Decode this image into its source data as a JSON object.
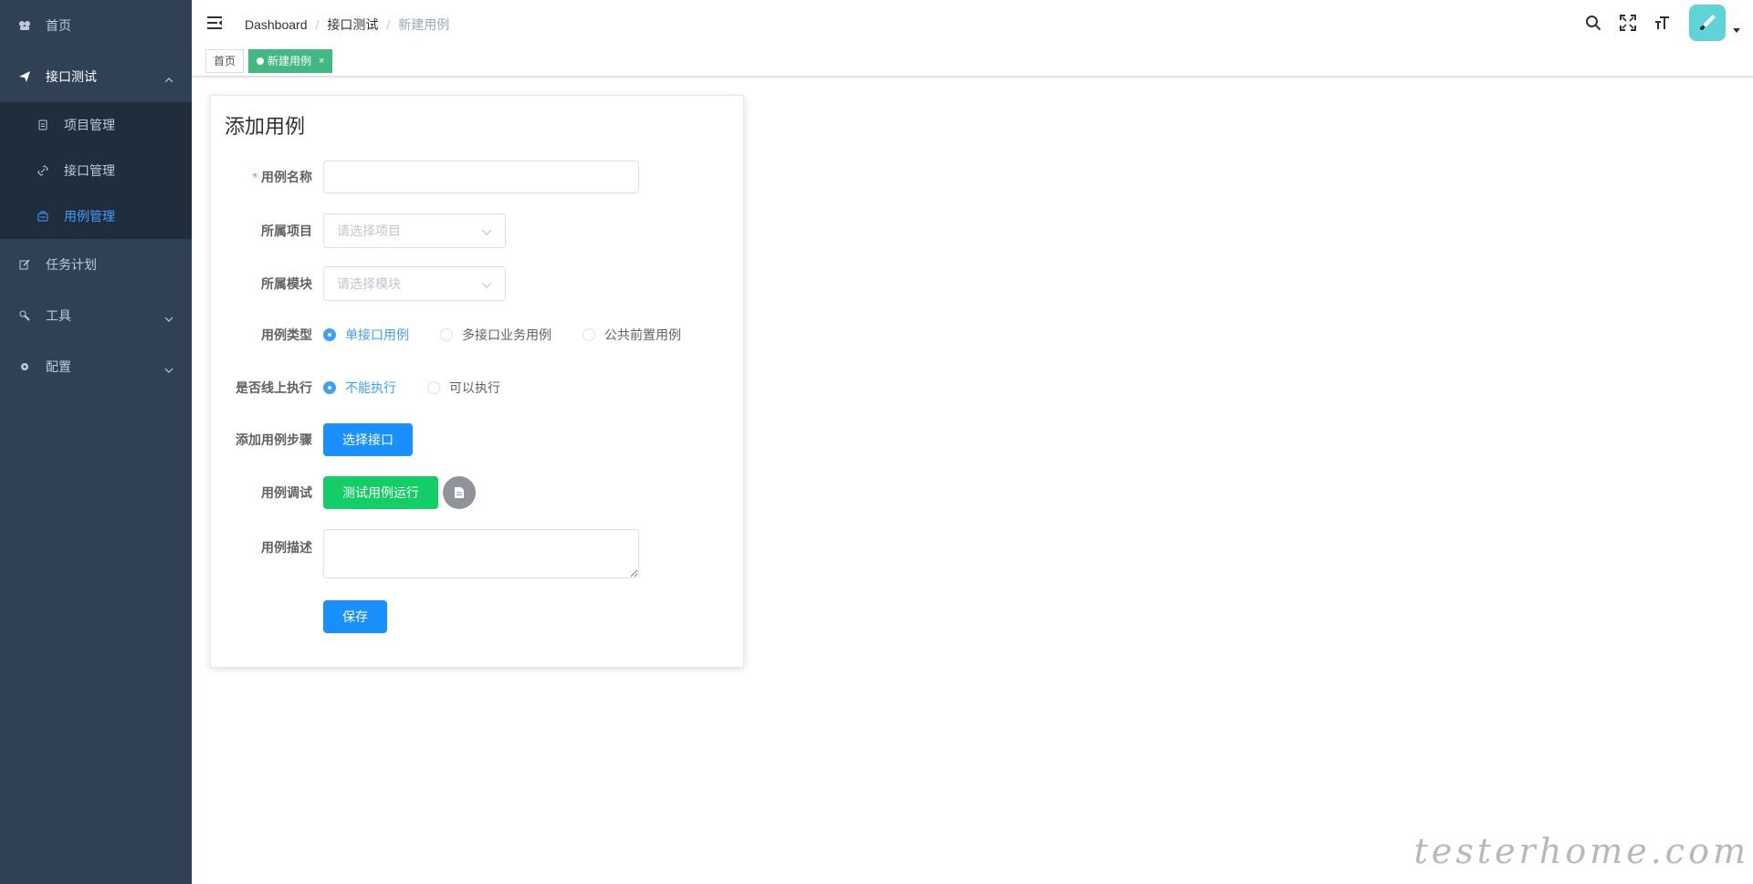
{
  "sidebar": {
    "home": "首页",
    "api_test": "接口测试",
    "sub": {
      "project": "项目管理",
      "interface": "接口管理",
      "case": "用例管理"
    },
    "task": "任务计划",
    "tools": "工具",
    "config": "配置"
  },
  "navbar": {
    "breadcrumb": [
      "Dashboard",
      "接口测试",
      "新建用例"
    ]
  },
  "tags": {
    "home": "首页",
    "active": "新建用例",
    "close": "×"
  },
  "form": {
    "title": "添加用例",
    "name_label": "用例名称",
    "name_value": "",
    "project_label": "所属项目",
    "project_placeholder": "请选择项目",
    "module_label": "所属模块",
    "module_placeholder": "请选择模块",
    "type_label": "用例类型",
    "type_options": [
      "单接口用例",
      "多接口业务用例",
      "公共前置用例"
    ],
    "online_label": "是否线上执行",
    "online_options": [
      "不能执行",
      "可以执行"
    ],
    "steps_label": "添加用例步骤",
    "select_api_button": "选择接口",
    "debug_label": "用例调试",
    "run_test_button": "测试用例运行",
    "desc_label": "用例描述",
    "desc_value": "",
    "save_button": "保存"
  },
  "watermark": "testerhome.com",
  "colors": {
    "sidebar_bg": "#304156",
    "submenu_bg": "#1f2d3d",
    "active_blue": "#409eff",
    "primary": "#1890ff",
    "success": "#13ce66",
    "tag_active": "#42b983"
  }
}
